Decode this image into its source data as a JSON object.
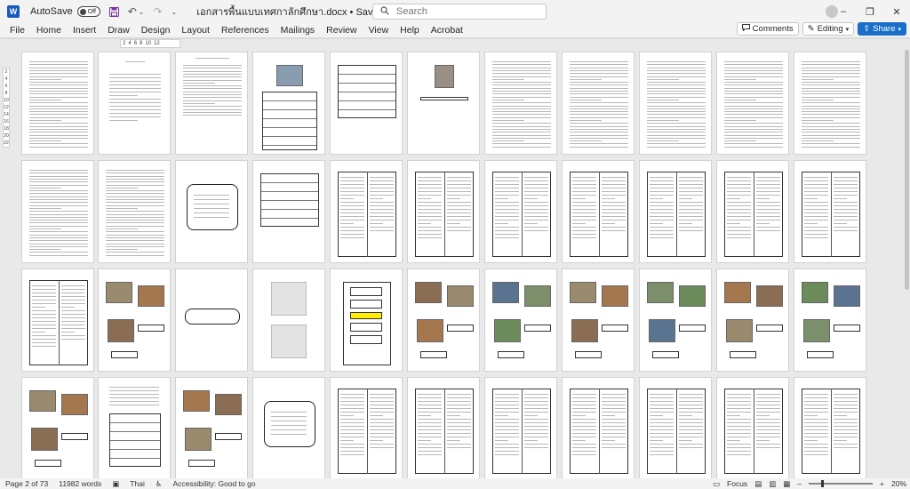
{
  "titlebar": {
    "app_icon": "W",
    "autosave_label": "AutoSave",
    "autosave_state": "Off",
    "doc_title": "เอกสารพื้นแบบเทศกาลักศึกษา.docx • Saved to this PC",
    "title_caret": "⌄"
  },
  "search": {
    "placeholder": "Search"
  },
  "menu": {
    "items": [
      "File",
      "Home",
      "Insert",
      "Draw",
      "Design",
      "Layout",
      "References",
      "Mailings",
      "Review",
      "View",
      "Help",
      "Acrobat"
    ],
    "comments_label": "Comments",
    "editing_label": "Editing",
    "share_label": "Share"
  },
  "ruler": {
    "ticks": [
      "2",
      "4",
      "6",
      "8",
      "10",
      "12"
    ]
  },
  "vruler": {
    "ticks": [
      "2",
      "4",
      "6",
      "8",
      "10",
      "12",
      "14",
      "16",
      "18",
      "20",
      "22"
    ]
  },
  "status": {
    "page": "Page 2 of 73",
    "words": "11982 words",
    "language": "Thai",
    "accessibility": "Accessibility: Good to go",
    "focus": "Focus",
    "zoom": "20%",
    "zoom_fraction": 0.2
  },
  "doc": {
    "page2_heading": "คำนำ",
    "page3_heading": "สารบัญ",
    "box_page_title": "เอกสารที่ใช้ระหว่างฝึกประสบการณ์ 4"
  }
}
